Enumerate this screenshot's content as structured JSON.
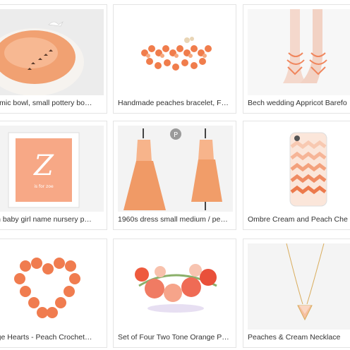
{
  "grid": {
    "items": [
      {
        "title": "eramic bowl, small pottery bo…",
        "image": "ceramic-bowl-image"
      },
      {
        "title": "Handmade peaches bracelet, F…",
        "image": "bracelet-image"
      },
      {
        "title": "Bech wedding Appricot Barefo",
        "image": "barefoot-sandals-image"
      },
      {
        "title": "ach baby girl name nursery p…",
        "image": "nursery-print-image"
      },
      {
        "title": "1960s dress small medium / pe…",
        "image": "vintage-dress-image"
      },
      {
        "title": "Ombre Cream and Peach Che",
        "image": "phone-case-image"
      },
      {
        "title": "ange Hearts - Peach Crochet…",
        "image": "crochet-hearts-image"
      },
      {
        "title": "Set of Four Two Tone Orange P…",
        "image": "flower-crown-image"
      },
      {
        "title": "Peaches & Cream Necklace",
        "image": "necklace-image"
      }
    ]
  },
  "print_letter": "Z",
  "print_text": "is for zoe",
  "colors": {
    "peach": "#f2a07b",
    "coral": "#ef7d56",
    "border": "#e4e4e4"
  }
}
